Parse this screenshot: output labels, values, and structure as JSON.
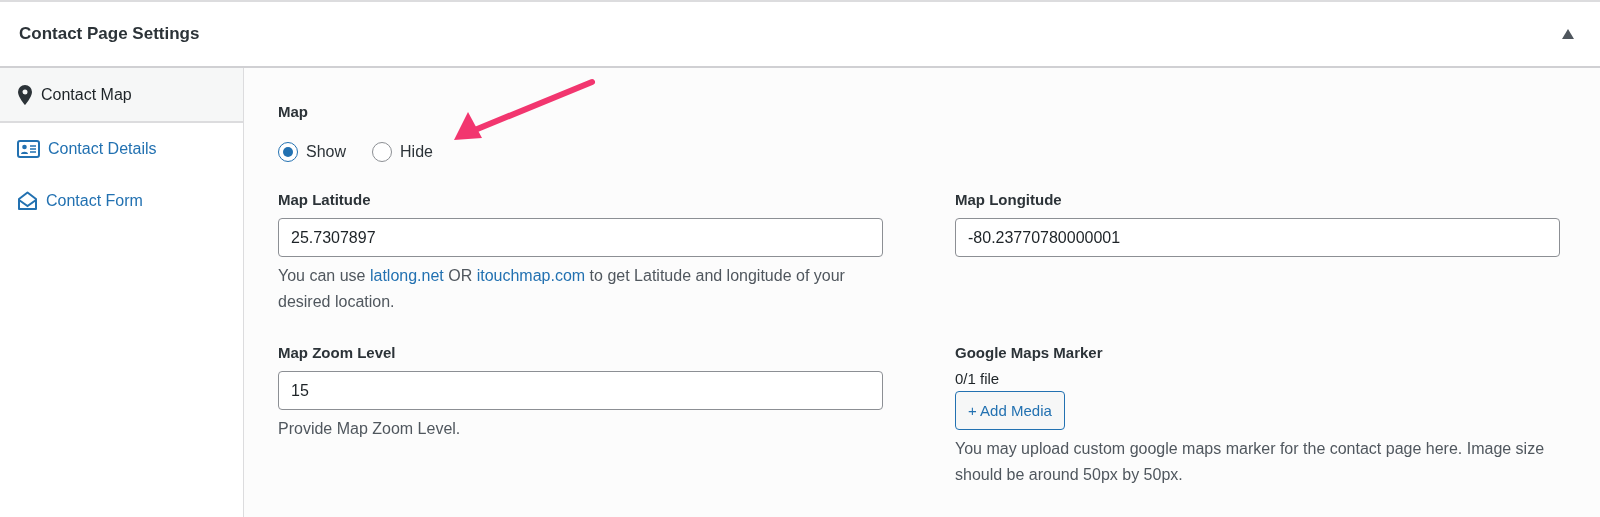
{
  "panel": {
    "title": "Contact Page Settings",
    "collapsed": false
  },
  "tabs": [
    {
      "label": "Contact Map",
      "selected": true
    },
    {
      "label": "Contact Details",
      "selected": false
    },
    {
      "label": "Contact Form",
      "selected": false
    }
  ],
  "map": {
    "label": "Map",
    "options": [
      {
        "label": "Show",
        "selected": true
      },
      {
        "label": "Hide",
        "selected": false
      }
    ]
  },
  "fields": [
    {
      "kind": "input",
      "label": "Map Latitude",
      "value": "25.7307897",
      "help": [
        {
          "kind": "text",
          "text": "You can use "
        },
        {
          "kind": "link",
          "text": "latlong.net"
        },
        {
          "kind": "text",
          "text": " OR "
        },
        {
          "kind": "link",
          "text": "itouchmap.com"
        },
        {
          "kind": "text",
          "text": " to get Latitude and longitude of your desired location."
        }
      ]
    },
    {
      "kind": "input",
      "label": "Map Longitude",
      "value": "-80.23770780000001"
    },
    {
      "kind": "input",
      "label": "Map Zoom Level",
      "value": "15",
      "help": [
        {
          "kind": "text",
          "text": "Provide Map Zoom Level."
        }
      ]
    },
    {
      "kind": "media",
      "label": "Google Maps Marker",
      "count": "0/1 file",
      "button": "+ Add Media",
      "help": [
        {
          "kind": "text",
          "text": "You may upload custom google maps marker for the contact page here. Image size should be around 50px by 50px."
        }
      ]
    }
  ]
}
